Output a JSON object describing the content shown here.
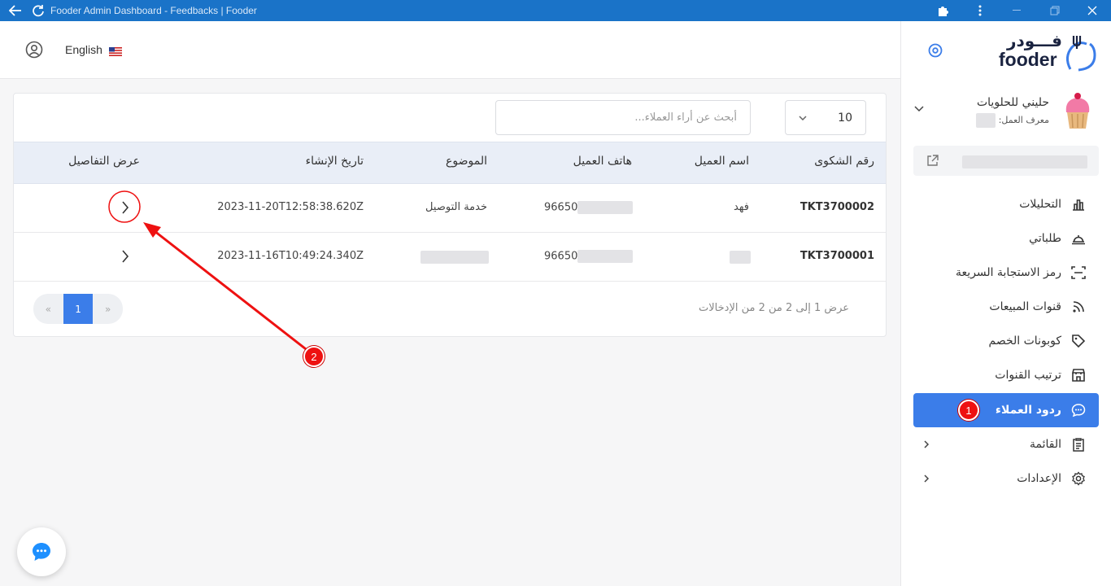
{
  "window": {
    "title": "Fooder Admin Dashboard - Feedbacks | Fooder"
  },
  "topbar": {
    "language": "English"
  },
  "brand": {
    "arabic": "فـــودر",
    "latin": "fooder"
  },
  "store": {
    "name": "حليني للحلويات",
    "id_label": "معرف العمل:"
  },
  "nav": {
    "items": [
      {
        "label": "التحليلات",
        "icon": "analytics-icon"
      },
      {
        "label": "طلباتي",
        "icon": "orders-dish-icon"
      },
      {
        "label": "رمز الاستجابة السريعة",
        "icon": "qr-code-icon"
      },
      {
        "label": "قنوات المبيعات",
        "icon": "rss-icon"
      },
      {
        "label": "كوبونات الخصم",
        "icon": "tag-icon"
      },
      {
        "label": "ترتيب القنوات",
        "icon": "store-icon"
      },
      {
        "label": "ردود العملاء",
        "icon": "chat-bubble-icon",
        "active": true
      },
      {
        "label": "القائمة",
        "icon": "clipboard-icon"
      },
      {
        "label": "الإعدادات",
        "icon": "gear-icon"
      }
    ]
  },
  "toolbar": {
    "per_page": "10",
    "search_placeholder": "أبحث عن أراء العملاء..."
  },
  "table": {
    "headers": {
      "ticket": "رقم الشكوى",
      "customer_name": "اسم العميل",
      "phone": "هاتف العميل",
      "subject": "الموضوع",
      "created": "تاريخ الإنشاء",
      "details": "عرض التفاصيل"
    },
    "rows": [
      {
        "ticket": "TKT3700002",
        "customer_name": "فهد",
        "phone": "96650",
        "subject": "خدمة التوصيل",
        "created": "2023-11-20T12:58:38.620Z"
      },
      {
        "ticket": "TKT3700001",
        "customer_name": "",
        "phone": "96650",
        "subject": "",
        "created": "2023-11-16T10:49:24.340Z"
      }
    ]
  },
  "pagination": {
    "prev": "«",
    "current": "1",
    "next": "»",
    "info": "عرض 1 إلى 2 من 2 من الإدخالات"
  },
  "annotations": {
    "badge1": "1",
    "badge2": "2"
  },
  "colors": {
    "titlebar": "#1a73c8",
    "accent": "#3b7de9",
    "annotation": "#e11111"
  }
}
